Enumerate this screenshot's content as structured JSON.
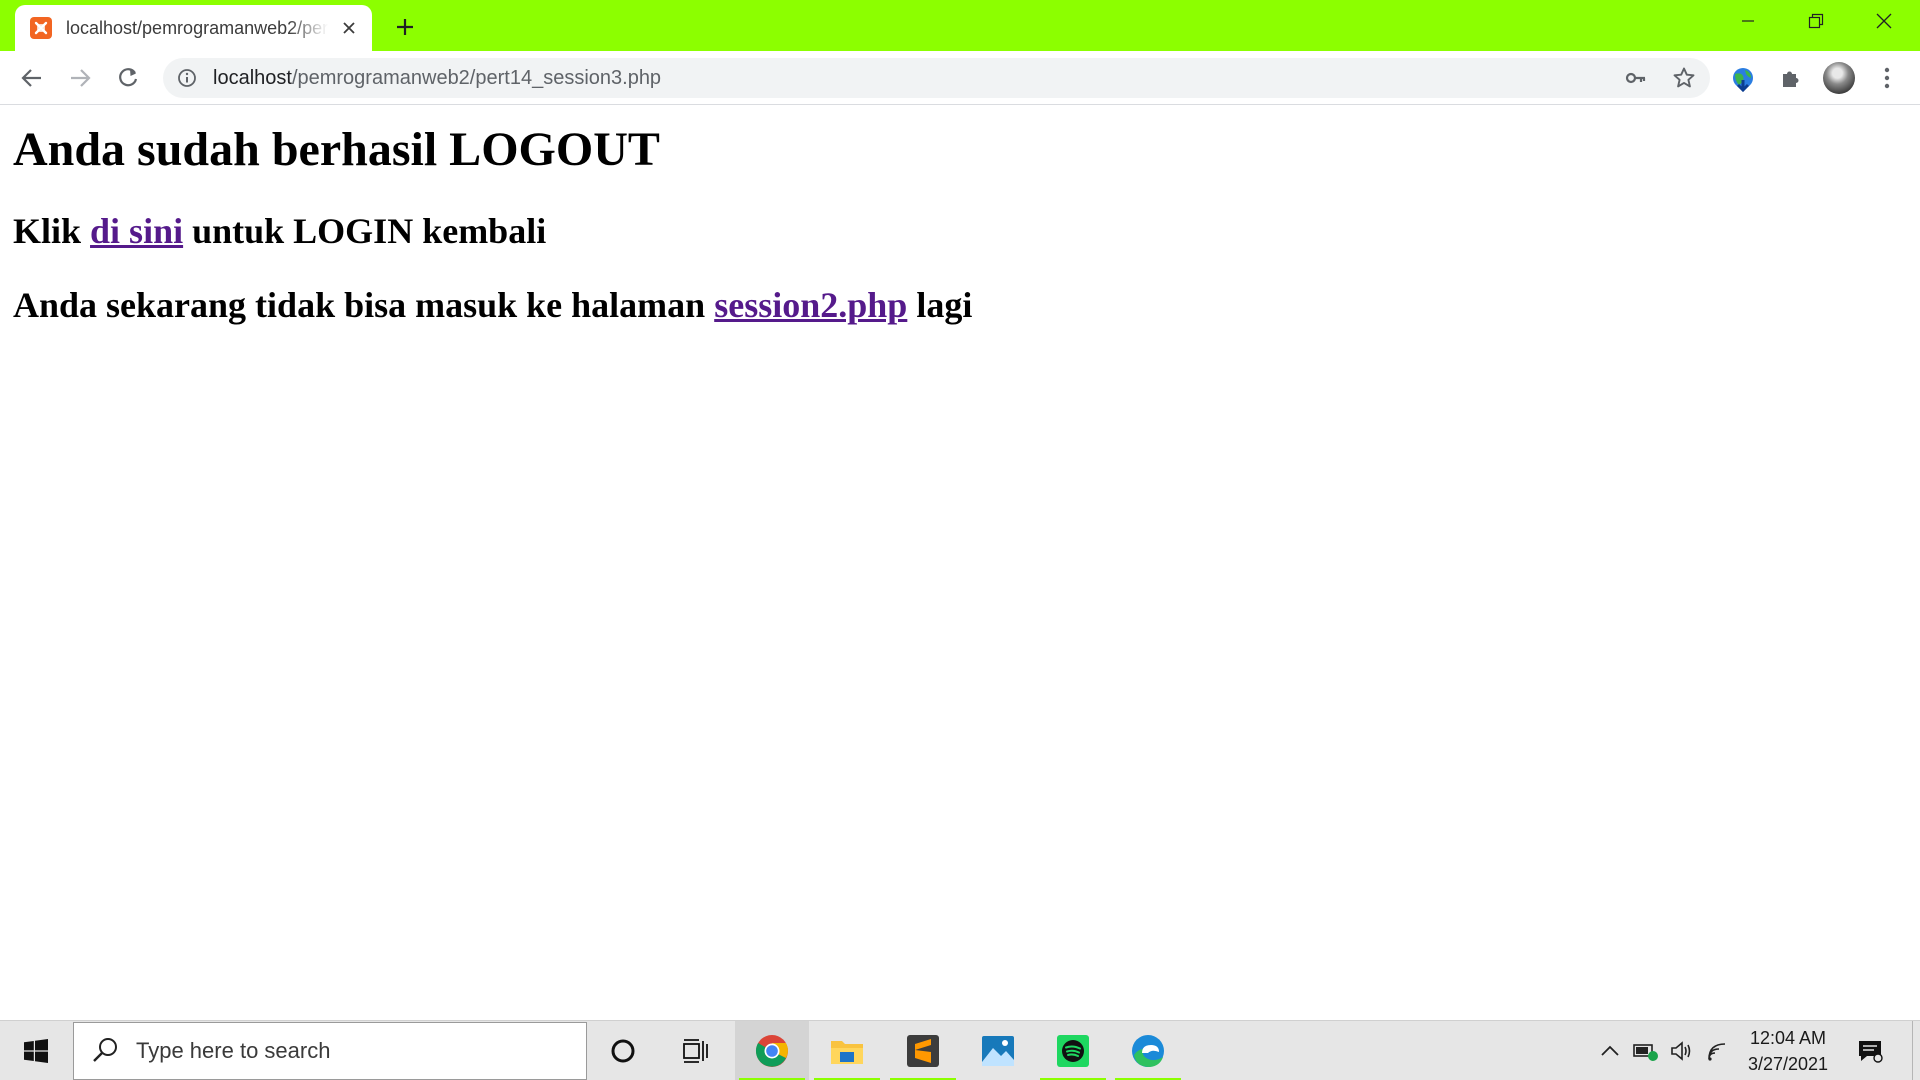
{
  "browser": {
    "tab": {
      "title": "localhost/pemrogramanweb2/pert14_session3.php",
      "favicon": "xampp-icon"
    },
    "address_bar": {
      "host": "localhost",
      "path": "/pemrogramanweb2/pert14_session3.php"
    },
    "icons": [
      "back-arrow-icon",
      "forward-arrow-icon",
      "reload-icon",
      "site-info-icon",
      "key-icon",
      "star-icon",
      "extension-globe-icon",
      "puzzle-icon",
      "profile-avatar",
      "kebab-menu-icon"
    ],
    "accent_color": "#8cff00"
  },
  "page": {
    "heading": "Anda sudah berhasil LOGOUT",
    "line1": {
      "before": "Klik ",
      "link": "di sini",
      "after": " untuk LOGIN kembali"
    },
    "line2": {
      "before": "Anda sekarang tidak bisa masuk ke halaman ",
      "link": "session2.php",
      "after": " lagi"
    },
    "link_color": "#551a8b"
  },
  "taskbar": {
    "search_placeholder": "Type here to search",
    "apps": [
      "chrome",
      "file-explorer",
      "sublime-text",
      "photos",
      "spotify",
      "edge"
    ],
    "clock": {
      "time": "12:04 AM",
      "date": "3/27/2021"
    }
  }
}
